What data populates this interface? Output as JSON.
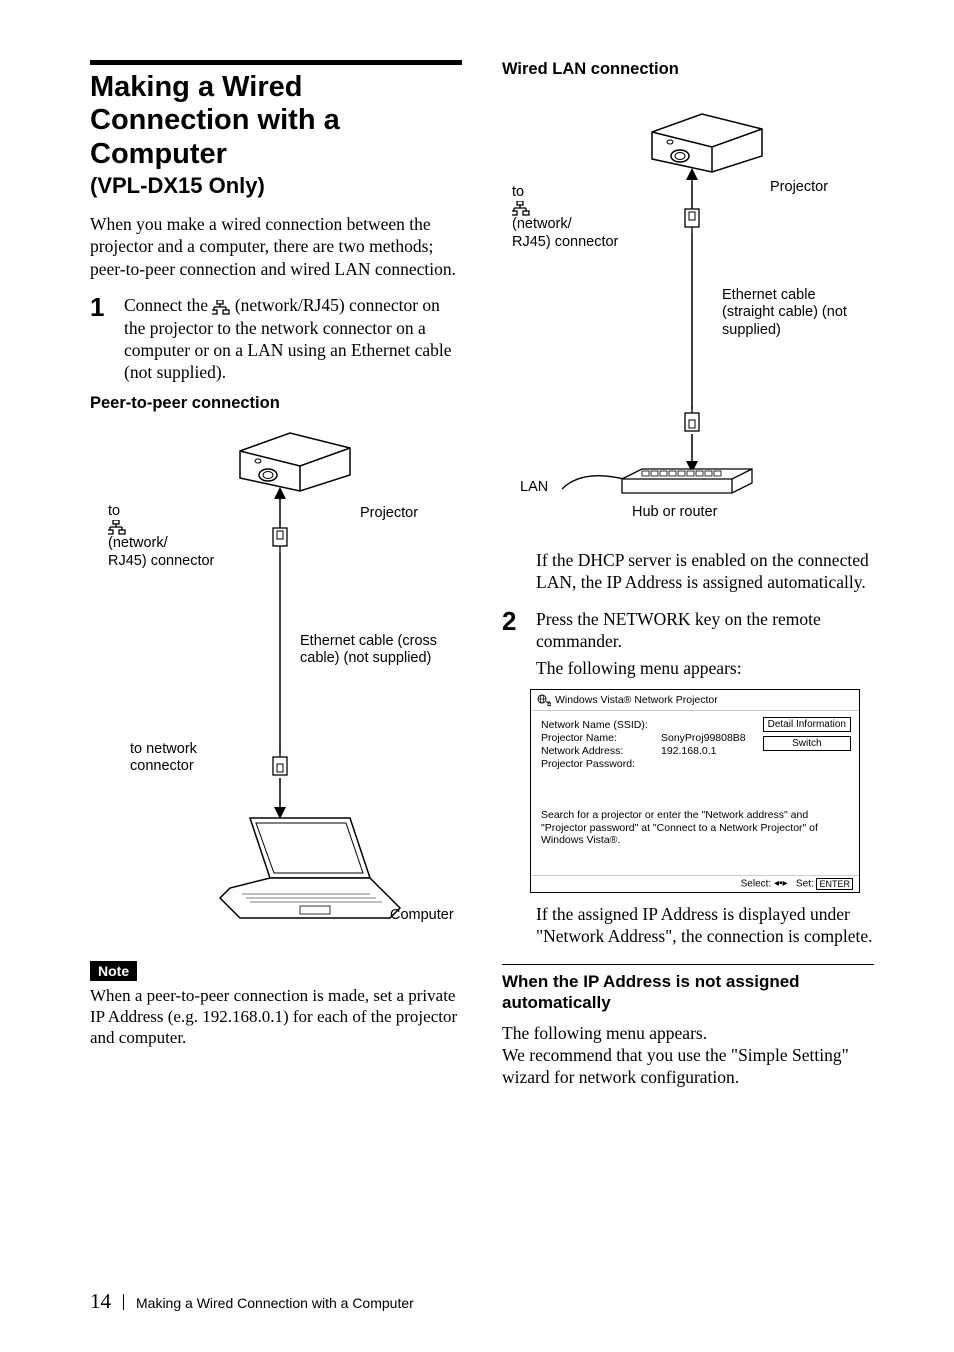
{
  "left": {
    "heading": "Making a Wired Connection with a Computer",
    "subtitle": "(VPL-DX15 Only)",
    "intro": "When you make a wired connection between the projector and a computer, there are two methods; peer-to-peer connection and wired LAN connection.",
    "step1_pre": "Connect the ",
    "step1_post": " (network/RJ45) connector on the projector to the network connector on a computer or on a LAN using an Ethernet cable (not supplied).",
    "p2p_heading": "Peer-to-peer connection",
    "fig1": {
      "to_net": "to ",
      "to_net2": " (network/\nRJ45) connector",
      "projector": "Projector",
      "cable": "Ethernet cable (cross cable) (not supplied)",
      "to_conn": "to network connector",
      "computer": "Computer"
    },
    "note_label": "Note",
    "note_text": "When a peer-to-peer connection is made, set a private IP Address (e.g. 192.168.0.1) for each of the projector and computer."
  },
  "right": {
    "wired_heading": "Wired LAN connection",
    "fig2": {
      "to_net": "to ",
      "to_net2": " (network/\nRJ45) connector",
      "projector": "Projector",
      "cable": "Ethernet cable (straight cable) (not supplied)",
      "lan": "LAN",
      "hub": "Hub or router"
    },
    "dhcp_text": "If the DHCP server is enabled on the connected LAN, the IP Address is assigned automatically.",
    "step2_a": "Press the NETWORK key on the remote commander.",
    "step2_b": "The following menu appears:",
    "menu": {
      "title": "Windows Vista® Network Projector",
      "rows": [
        {
          "label": "Network Name (SSID):",
          "value": ""
        },
        {
          "label": "Projector Name:",
          "value": "SonyProj99808B8"
        },
        {
          "label": "Network Address:",
          "value": "192.168.0.1"
        },
        {
          "label": "Projector Password:",
          "value": ""
        }
      ],
      "btn1": "Detail Information",
      "btn2": "Switch",
      "instruction": "Search for a projector or enter the \"Network address\" and \"Projector password\" at \"Connect to a Network Projector\" of Windows Vista®.",
      "foot_select": "Select:",
      "foot_set": "Set:",
      "foot_enter": "ENTER"
    },
    "after_menu": "If the assigned IP Address is displayed under \"Network Address\", the connection is complete.",
    "ip_heading": "When the IP Address is not assigned automatically",
    "ip_text": "The following menu appears.\nWe recommend that you use the \"Simple Setting\" wizard for network configuration."
  },
  "footer": {
    "page": "14",
    "title": "Making a Wired Connection with a Computer"
  },
  "chart_data": {
    "type": "table",
    "title": "Windows Vista® Network Projector menu values",
    "rows": [
      {
        "field": "Network Name (SSID)",
        "value": ""
      },
      {
        "field": "Projector Name",
        "value": "SonyProj99808B8"
      },
      {
        "field": "Network Address",
        "value": "192.168.0.1"
      },
      {
        "field": "Projector Password",
        "value": ""
      }
    ]
  }
}
